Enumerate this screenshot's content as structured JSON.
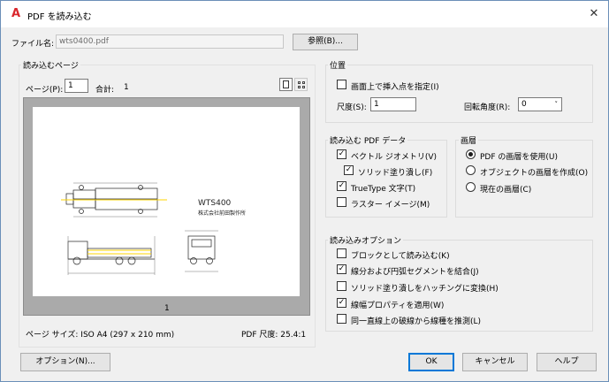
{
  "window": {
    "title": "PDF を読み込む",
    "close": "✕"
  },
  "file": {
    "label": "ファイル名:",
    "value": "wts0400.pdf",
    "browse": "参照(B)..."
  },
  "pages": {
    "section": "読み込むページ",
    "page_label": "ページ(P):",
    "page_value": "1",
    "total_label": "合計:",
    "total_value": "1",
    "page_number": "1",
    "page_size": "ページ サイズ: ISO A4 (297 x 210 mm)",
    "pdf_scale": "PDF 尺度: 25.4:1"
  },
  "drawing": {
    "title": "WTS400",
    "company": "株式会社前田製作所"
  },
  "position": {
    "section": "位置",
    "specify_on_screen": "画面上で挿入点を指定(I)",
    "scale_label": "尺度(S):",
    "scale_value": "1",
    "rotation_label": "回転角度(R):",
    "rotation_value": "0"
  },
  "pdf_data": {
    "section": "読み込む PDF データ",
    "vector": "ベクトル ジオメトリ(V)",
    "solid_fill": "ソリッド塗り潰し(F)",
    "truetype": "TrueType 文字(T)",
    "raster": "ラスター イメージ(M)"
  },
  "layers": {
    "section": "画層",
    "use_pdf": "PDF の画層を使用(U)",
    "create_object": "オブジェクトの画層を作成(O)",
    "current": "現在の画層(C)"
  },
  "options": {
    "section": "読み込みオプション",
    "as_block": "ブロックとして読み込む(K)",
    "join_segments": "線分および円弧セグメントを結合(J)",
    "hatch": "ソリッド塗り潰しをハッチングに変換(H)",
    "lineweight": "線幅プロパティを適用(W)",
    "infer_linetype": "同一直線上の破線から線種を推測(L)"
  },
  "footer": {
    "options": "オプション(N)...",
    "ok": "OK",
    "cancel": "キャンセル",
    "help": "ヘルプ"
  },
  "colors": {
    "accent": "#0078d7",
    "brand": "#d9262c",
    "drawing_highlight": "#ffff00"
  }
}
